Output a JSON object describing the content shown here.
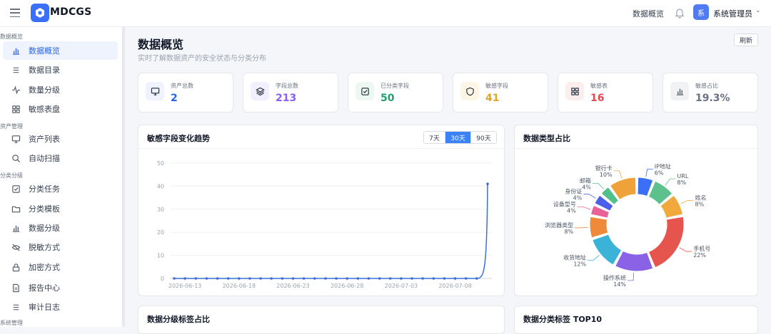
{
  "app": {
    "brand": "MDCGS"
  },
  "topbar": {
    "link": "数据概览",
    "user_avatar": "系",
    "user_name": "系统管理员"
  },
  "sidebar": {
    "sections": [
      "数据概览",
      "资产管理",
      "分类分级",
      "系统管理"
    ],
    "items": [
      {
        "label": "数据概览",
        "icon": "bar-chart-icon",
        "active": true
      },
      {
        "label": "数据目录",
        "icon": "list-icon"
      },
      {
        "label": "数量分级",
        "icon": "activity-icon"
      },
      {
        "label": "敏感表盘",
        "icon": "grid-icon"
      },
      {
        "label": "资产列表",
        "icon": "monitor-icon"
      },
      {
        "label": "自动扫描",
        "icon": "search-icon"
      },
      {
        "label": "分类任务",
        "icon": "checkbox-icon"
      },
      {
        "label": "分类模板",
        "icon": "folder-icon"
      },
      {
        "label": "数据分级",
        "icon": "bar-chart-icon"
      },
      {
        "label": "脱敏方式",
        "icon": "eye-off-icon"
      },
      {
        "label": "加密方式",
        "icon": "lock-icon"
      },
      {
        "label": "报告中心",
        "icon": "file-icon"
      },
      {
        "label": "审计日志",
        "icon": "list-icon"
      }
    ]
  },
  "page": {
    "title": "数据概览",
    "subtitle": "实时了解数据资产的安全状态与分类分布",
    "refresh": "刷新"
  },
  "stats": [
    {
      "label": "资产总数",
      "value": "2",
      "color": "#2563eb",
      "icon": "monitor-icon"
    },
    {
      "label": "字段总数",
      "value": "213",
      "color": "#8b5cf6",
      "icon": "layers-icon"
    },
    {
      "label": "已分类字段",
      "value": "50",
      "color": "#22a06b",
      "icon": "checkbox-icon"
    },
    {
      "label": "敏感字段",
      "value": "41",
      "color": "#e0a526",
      "icon": "shield-icon"
    },
    {
      "label": "敏感表",
      "value": "16",
      "color": "#e5484d",
      "icon": "grid-icon"
    },
    {
      "label": "敏感占比",
      "value": "19.3%",
      "color": "#6b7280",
      "icon": "bar-chart-icon"
    }
  ],
  "trend_panel": {
    "title": "敏感字段变化趋势",
    "ranges": [
      "7天",
      "30天",
      "90天"
    ],
    "active_range": "30天"
  },
  "donut_panel": {
    "title": "数据类型占比"
  },
  "bottom_panels": {
    "left_title": "数据分级标签占比",
    "right_title": "数据分类标签 TOP10"
  },
  "chart_data": [
    {
      "type": "line",
      "title": "敏感字段变化趋势",
      "ylim": [
        0,
        50
      ],
      "yticks": [
        0,
        10,
        20,
        30,
        40,
        50
      ],
      "xticks": [
        "2026-06-13",
        "2026-06-18",
        "2026-06-23",
        "2026-06-28",
        "2026-07-03",
        "2026-07-08"
      ],
      "x_start": "2026-06-12",
      "y": [
        0,
        0,
        0,
        0,
        0,
        0,
        0,
        0,
        0,
        0,
        0,
        0,
        0,
        0,
        0,
        0,
        0,
        0,
        0,
        0,
        0,
        0,
        0,
        0,
        0,
        0,
        0,
        0,
        0,
        41
      ],
      "color": "#3b6fd8"
    },
    {
      "type": "pie",
      "title": "数据类型占比",
      "slices": [
        {
          "label": "IP地址",
          "value": 6,
          "color": "#3b6ff5"
        },
        {
          "label": "URL",
          "value": 8,
          "color": "#5cc18d"
        },
        {
          "label": "姓名",
          "value": 8,
          "color": "#f2a93b"
        },
        {
          "label": "手机号",
          "value": 22,
          "color": "#e5544d"
        },
        {
          "label": "操作系统",
          "value": 14,
          "color": "#8a62e6"
        },
        {
          "label": "收货地址",
          "value": 12,
          "color": "#3bb3d8"
        },
        {
          "label": "浏览器类型",
          "value": 8,
          "color": "#f08a3b"
        },
        {
          "label": "设备型号",
          "value": 4,
          "color": "#e8629a"
        },
        {
          "label": "身份证",
          "value": 4,
          "color": "#4a5ee8"
        },
        {
          "label": "邮箱",
          "value": 4,
          "color": "#52c08a"
        },
        {
          "label": "银行卡",
          "value": 10,
          "color": "#f0a23a"
        }
      ]
    }
  ]
}
